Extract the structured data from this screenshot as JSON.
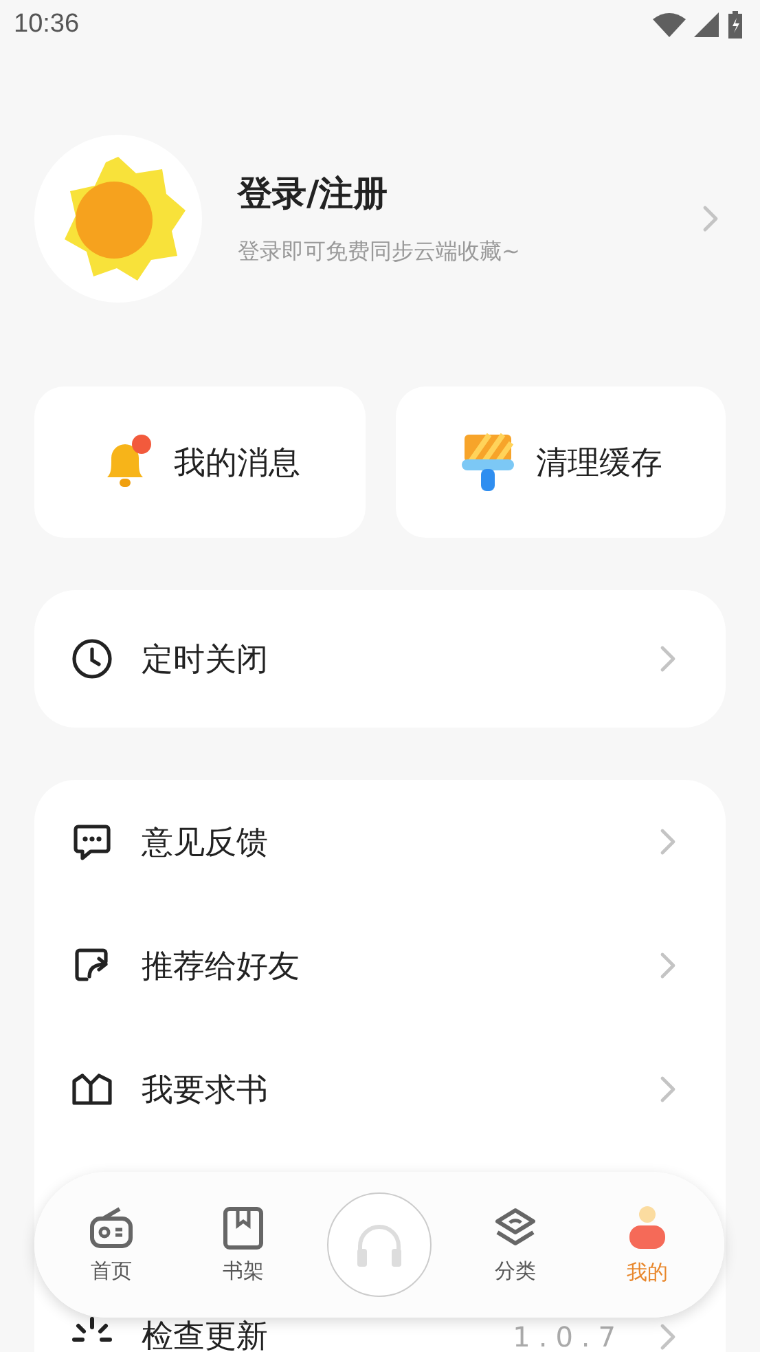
{
  "status_bar": {
    "time": "10:36"
  },
  "profile": {
    "title": "登录/注册",
    "subtitle": "登录即可免费同步云端收藏~"
  },
  "quick_actions": [
    {
      "kind": "bell",
      "label": "我的消息"
    },
    {
      "kind": "brush",
      "label": "清理缓存"
    }
  ],
  "timer": {
    "kind": "clock",
    "label": "定时关闭"
  },
  "menu": [
    {
      "kind": "chat",
      "label": "意见反馈"
    },
    {
      "kind": "share",
      "label": "推荐给好友"
    },
    {
      "kind": "book",
      "label": "我要求书"
    },
    {
      "kind": "update",
      "label": "检查更新",
      "value": "1.0.7"
    }
  ],
  "bottom_nav": [
    {
      "kind": "radio",
      "label": "首页",
      "selected": false
    },
    {
      "kind": "bookmark",
      "label": "书架",
      "selected": false
    },
    {
      "kind": "listen",
      "selected": false
    },
    {
      "kind": "layers",
      "label": "分类",
      "selected": false
    },
    {
      "kind": "person",
      "label": "我的",
      "selected": true
    }
  ]
}
